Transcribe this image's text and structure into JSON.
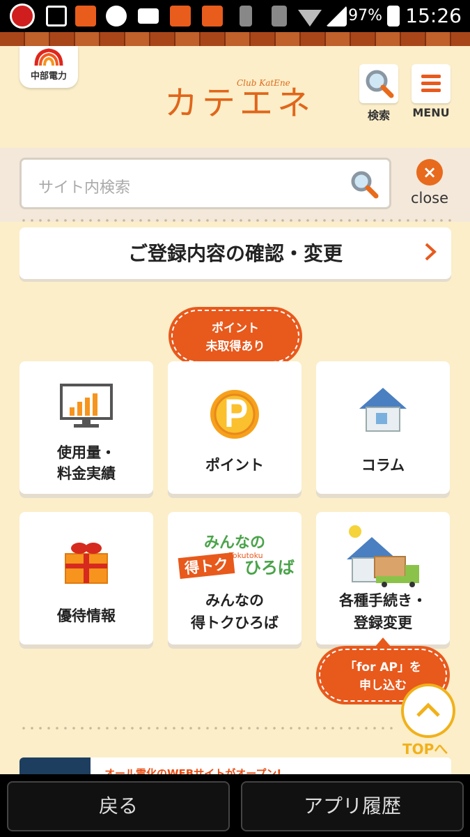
{
  "status_bar": {
    "battery": "97%",
    "time": "15:26",
    "network": "4G"
  },
  "header": {
    "logo_text": "中部電力",
    "brand_title": "カテエネ",
    "brand_subtitle": "Club KatEne",
    "search_label": "検索",
    "menu_label": "MENU"
  },
  "search": {
    "placeholder": "サイト内検索",
    "close_label": "close"
  },
  "registration": {
    "label": "ご登録内容の確認・変更"
  },
  "point_bubble": {
    "line1": "ポイント",
    "line2": "未取得あり"
  },
  "tiles": [
    {
      "line1": "使用量・",
      "line2": "料金実績",
      "icon": "monitor-chart-icon"
    },
    {
      "line1": "ポイント",
      "line2": "",
      "icon": "point-coin-icon"
    },
    {
      "line1": "コラム",
      "line2": "",
      "icon": "house-icon"
    },
    {
      "line1": "優待情報",
      "line2": "",
      "icon": "gift-box-icon"
    },
    {
      "line1": "みんなの",
      "line2": "得トクひろば",
      "icon": "tokutoku-logo-icon",
      "logo_top": "みんなの",
      "logo_main": "得トク",
      "logo_side": "ひろば",
      "logo_small": "Tokutoku"
    },
    {
      "line1": "各種手続き・",
      "line2": "登録変更",
      "icon": "house-truck-icon"
    }
  ],
  "forap_bubble": {
    "line1": "「for AP」を",
    "line2": "申し込む"
  },
  "top_button": {
    "label": "TOPへ"
  },
  "news": {
    "text": "オール電化のWEBサイトがオープン!"
  },
  "bottom_nav": {
    "back": "戻る",
    "history": "アプリ履歴"
  },
  "colors": {
    "accent": "#e8591c",
    "background": "#fbeec9",
    "top_button": "#f1b11b"
  }
}
